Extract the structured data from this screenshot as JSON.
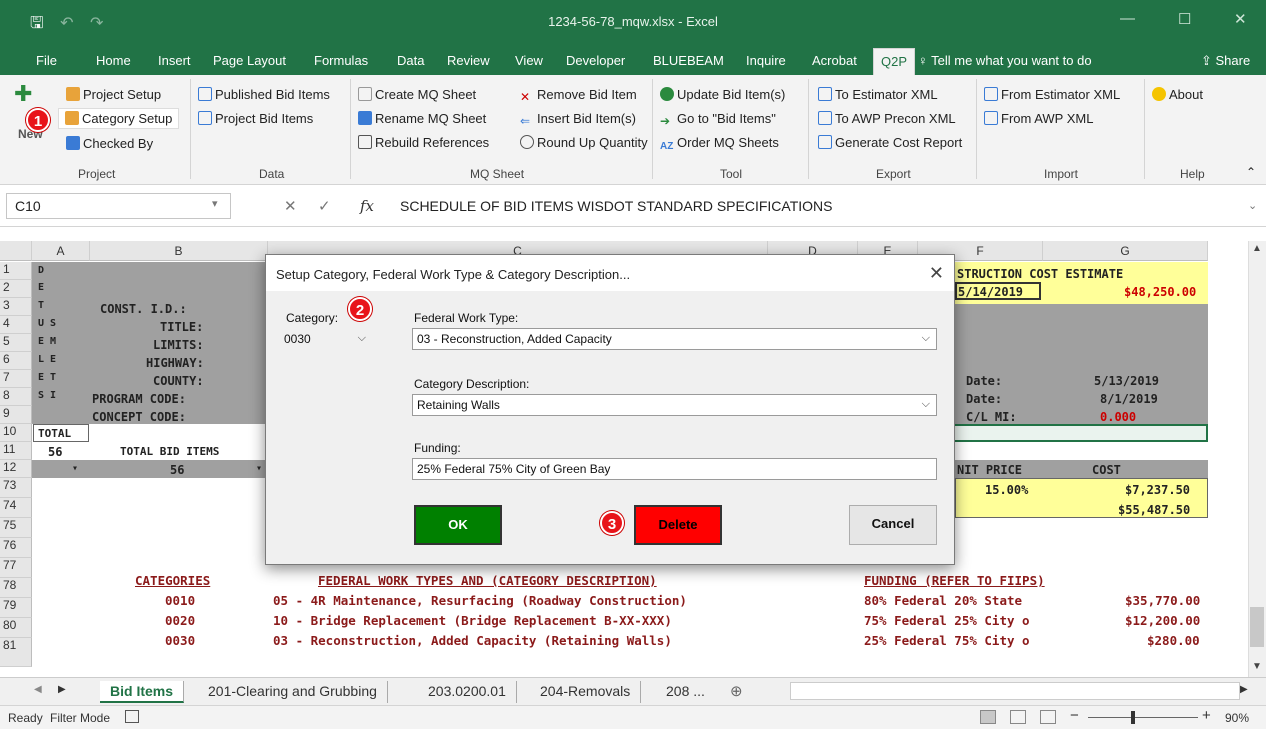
{
  "window": {
    "title": "1234-56-78_mqw.xlsx  -  Excel",
    "qat_save": "🖫",
    "qat_undo": "↶",
    "qat_redo": "↷"
  },
  "menu": {
    "tabs": [
      "File",
      "Home",
      "Insert",
      "Page Layout",
      "Formulas",
      "Data",
      "Review",
      "View",
      "Developer",
      "BLUEBEAM",
      "Inquire",
      "Acrobat",
      "Q2P"
    ],
    "tell_me": "Tell me what you want to do",
    "share": "Share"
  },
  "ribbon": {
    "project": {
      "new": "New",
      "items": [
        "Project Setup",
        "Category Setup",
        "Checked By"
      ],
      "label": "Project"
    },
    "data": {
      "items": [
        "Published Bid Items",
        "Project Bid Items"
      ],
      "label": "Data"
    },
    "mq_sheet": {
      "items": [
        "Create MQ Sheet",
        "Rename MQ Sheet",
        "Rebuild References",
        "Remove Bid Item",
        "Insert Bid Item(s)",
        "Round Up Quantity"
      ],
      "label": "MQ Sheet"
    },
    "tool": {
      "items": [
        "Update Bid Item(s)",
        "Go to \"Bid Items\"",
        "Order MQ Sheets"
      ],
      "label": "Tool"
    },
    "export": {
      "items": [
        "To Estimator XML",
        "To AWP Precon XML",
        "Generate Cost Report"
      ],
      "label": "Export"
    },
    "import": {
      "items": [
        "From Estimator XML",
        "From AWP XML"
      ],
      "label": "Import"
    },
    "help": {
      "items": [
        "About"
      ],
      "label": "Help"
    }
  },
  "formula_bar": {
    "name_box": "C10",
    "fx": "fx",
    "content": "SCHEDULE OF BID ITEMS  WISDOT STANDARD SPECIFICATIONS"
  },
  "grid": {
    "columns": [
      "A",
      "B",
      "C",
      "D",
      "E",
      "F",
      "G"
    ],
    "rows": [
      "1",
      "2",
      "3",
      "4",
      "5",
      "6",
      "7",
      "8",
      "9",
      "10",
      "11",
      "12",
      "73",
      "74",
      "75",
      "76",
      "77",
      "78",
      "79",
      "80",
      "81"
    ],
    "col_a_letters": [
      "D",
      "E",
      "T",
      "U S",
      "E M",
      "L E",
      "E T",
      "S I"
    ],
    "b_labels": [
      "CONST. I.D.:",
      "TITLE:",
      "LIMITS:",
      "HIGHWAY:",
      "COUNTY:",
      "PROGRAM CODE:",
      "CONCEPT CODE:"
    ],
    "a10": "TOTAL",
    "a11": "56",
    "b11": "TOTAL BID ITEMS",
    "b12": "56",
    "f1": "STRUCTION COST ESTIMATE",
    "f2": "5/14/2019",
    "g2": "$48,250.00",
    "date_label_1": "Date:",
    "date_val_1": "5/13/2019",
    "date_label_2": "Date:",
    "date_val_2": "8/1/2019",
    "cl_label": "C/L MI:",
    "cl_val": "0.000",
    "hdr_unit_price": "NIT PRICE",
    "hdr_cost": "COST",
    "f73": "15.00%",
    "g73": "$7,237.50",
    "g74": "$55,487.50",
    "table_headers": [
      "CATEGORIES",
      "FEDERAL WORK TYPES AND (CATEGORY DESCRIPTION)",
      "FUNDING (REFER TO FIIPS)"
    ],
    "table_rows": [
      {
        "cat": "0010",
        "type": "05 - 4R Maintenance, Resurfacing (Roadway Construction)",
        "fund": "80% Federal 20% State",
        "amount": "$35,770.00"
      },
      {
        "cat": "0020",
        "type": "10 - Bridge Replacement (Bridge Replacement B-XX-XXX)",
        "fund": "75% Federal 25% City o",
        "amount": "$12,200.00"
      },
      {
        "cat": "0030",
        "type": "03 - Reconstruction, Added Capacity (Retaining Walls)",
        "fund": "25% Federal 75% City o",
        "amount": "$280.00"
      }
    ]
  },
  "sheet_tabs": [
    "Bid Items",
    "201-Clearing and Grubbing",
    "203.0200.01",
    "204-Removals",
    "208 ..."
  ],
  "status": {
    "ready": "Ready",
    "mode": "Filter Mode",
    "zoom": "90%"
  },
  "dialog": {
    "title": "Setup Category, Federal Work Type & Category Description...",
    "category_label": "Category:",
    "category_value": "0030",
    "work_type_label": "Federal Work Type:",
    "work_type_value": "03 - Reconstruction, Added Capacity",
    "desc_label": "Category Description:",
    "desc_value": "Retaining Walls",
    "funding_label": "Funding:",
    "funding_value": "25% Federal 75% City of Green Bay",
    "ok": "OK",
    "delete": "Delete",
    "cancel": "Cancel"
  },
  "badges": [
    "1",
    "2",
    "3"
  ],
  "colors": {
    "excel_green": "#217346",
    "ok_green": "#008000",
    "delete_red": "#ff0000",
    "badge_red": "#e8141a"
  }
}
